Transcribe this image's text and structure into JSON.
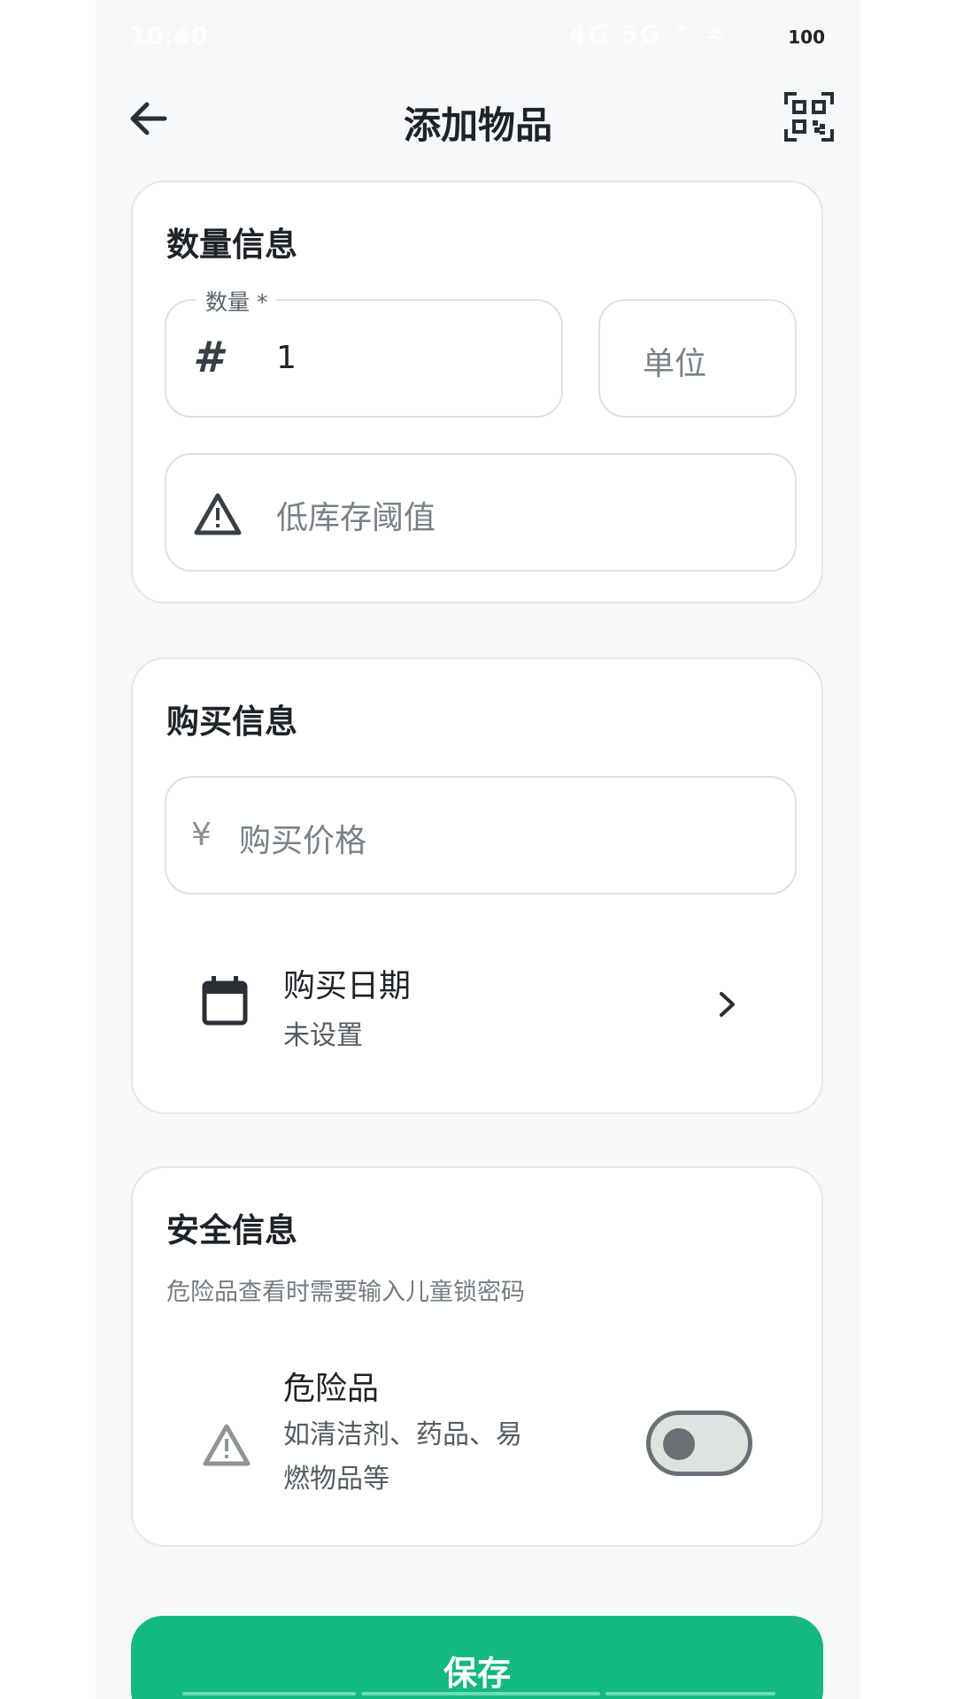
{
  "status_bar": {
    "time": "10:40",
    "icons": "4G 5G ⇡ ≈",
    "battery": "100"
  },
  "header": {
    "title": "添加物品",
    "back_icon": "arrow-left-icon",
    "scan_icon": "qr-scan-icon"
  },
  "quantity_section": {
    "title": "数量信息",
    "quantity_label": "数量 *",
    "quantity_value": "1",
    "quantity_icon": "#",
    "unit_placeholder": "单位",
    "threshold_placeholder": "低库存阈值"
  },
  "purchase_section": {
    "title": "购买信息",
    "currency_symbol": "¥",
    "price_placeholder": "购买价格",
    "date_title": "购买日期",
    "date_value": "未设置"
  },
  "safety_section": {
    "title": "安全信息",
    "description": "危险品查看时需要输入儿童锁密码",
    "hazard_title": "危险品",
    "hazard_desc_line1": "如清洁剂、药品、易",
    "hazard_desc_line2": "燃物品等",
    "hazard_enabled": false
  },
  "actions": {
    "save_label": "保存"
  },
  "colors": {
    "accent": "#13b97f",
    "background": "#f6f8fa",
    "card": "#ffffff"
  }
}
